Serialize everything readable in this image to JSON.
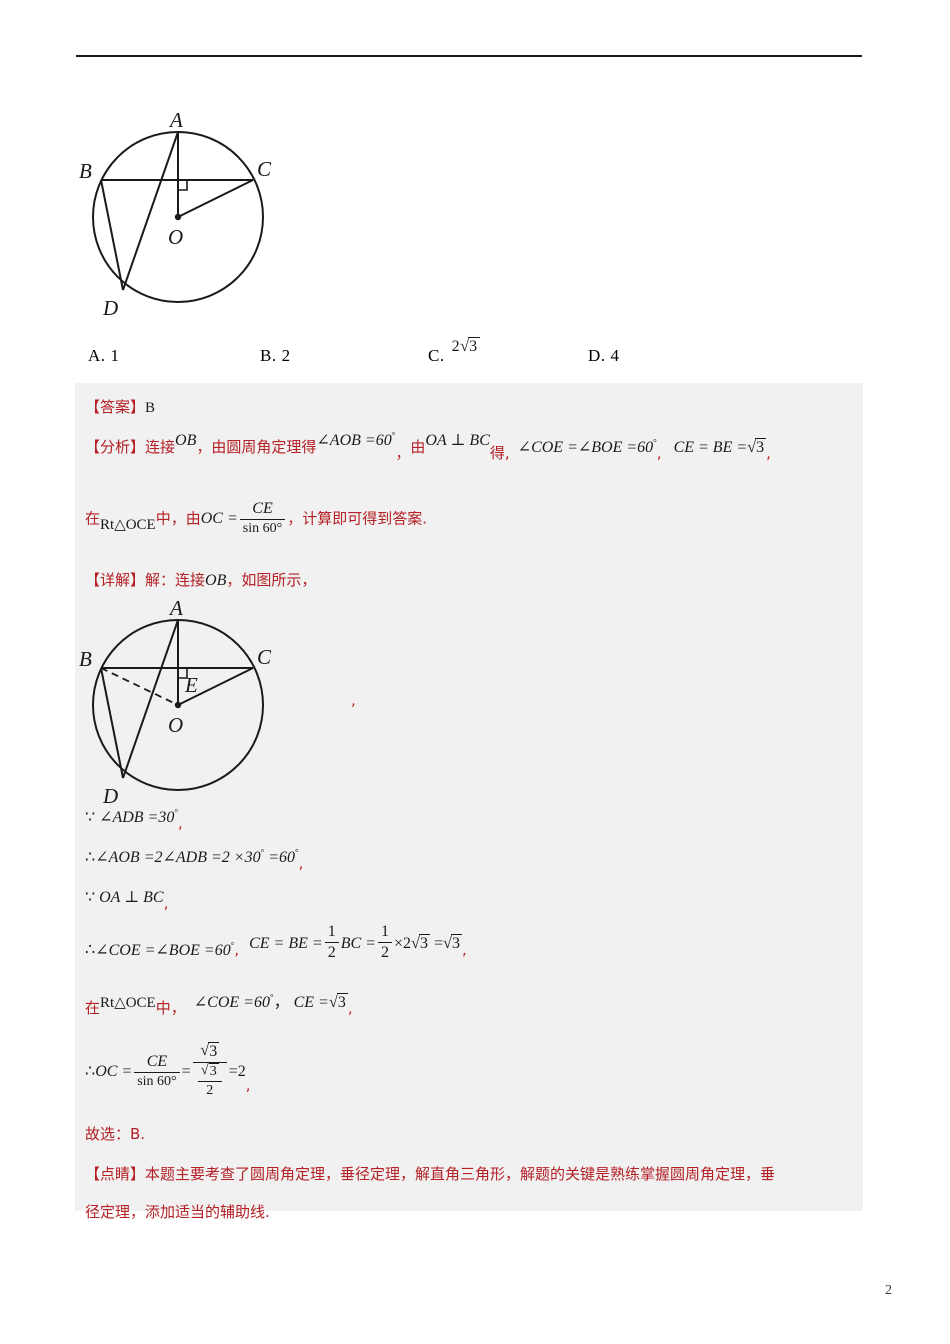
{
  "document": {
    "page_number": "2",
    "header_rule": true
  },
  "figure1": {
    "name": "circle-diagram-1",
    "labels": {
      "A": "A",
      "B": "B",
      "C": "C",
      "D": "D",
      "O": "O"
    },
    "right_angle_mark": true,
    "dashed_segment": false
  },
  "figure2": {
    "name": "circle-diagram-2",
    "labels": {
      "A": "A",
      "B": "B",
      "C": "C",
      "D": "D",
      "O": "O",
      "E": "E"
    },
    "right_angle_mark": true,
    "dashed_segment": true,
    "trailing_comma": ","
  },
  "options": [
    {
      "label": "A.",
      "value": "1"
    },
    {
      "label": "B.",
      "value": "2"
    },
    {
      "label": "C.",
      "value_prefix": "2",
      "value_sqrt": "3"
    },
    {
      "label": "D.",
      "value": "4"
    }
  ],
  "answer": {
    "tag": "【答案】",
    "value": "B"
  },
  "analysis": {
    "tag": "【分析】",
    "t1": "连接",
    "m1": "OB",
    "c1": "，",
    "t2": "由圆周角定理得",
    "m2": "∠AOB =60",
    "deg2": "°",
    "c2": "，",
    "t3": "由",
    "m3": "OA ⊥ BC",
    "t4": "得,",
    "m4": "∠COE =∠BOE =60",
    "deg4": "°",
    "c3": ",",
    "m5a": "CE = BE =",
    "m5_sqrt": "3",
    "c4": ",",
    "line2_t1": "在",
    "line2_m1": "Rt△OCE",
    "line2_t2": "中，由",
    "line2_m2": "OC =",
    "line2_frac_num": "CE",
    "line2_frac_den": "sin 60°",
    "line2_c1": "，",
    "line2_t3": "计算即可得到答案."
  },
  "solution": {
    "tag": "【详解】",
    "t1": "解：连接",
    "m1": "OB",
    "c1": "，",
    "t2": "如图所示，",
    "steps": [
      {
        "name": "step-adb",
        "prefix": "∵",
        "math": "∠ADB =30",
        "deg": "°",
        "comma": ","
      },
      {
        "name": "step-aob",
        "prefix": "∴",
        "math": "∠AOB =2∠ADB =2 ×30",
        "deg": "°",
        "math2": " =60",
        "deg2": "°",
        "comma": ","
      },
      {
        "name": "step-oa-perp-bc",
        "prefix": "∵",
        "math": "OA ⊥ BC",
        "comma": ","
      }
    ],
    "step_coe": {
      "prefix": "∴",
      "math": "∠COE =∠BOE =60",
      "deg": "°",
      "comma": ",",
      "math2a": "CE = BE =",
      "frac1_num": "1",
      "frac1_den": "2",
      "math2b": "BC =",
      "frac2_num": "1",
      "frac2_den": "2",
      "math2c": "×2",
      "sqrt1": "3",
      "math2d": " =",
      "sqrt2": "3",
      "comma2": ","
    },
    "step_rt": {
      "t1": "在",
      "m1": "Rt△OCE",
      "t2": "中，",
      "m2": "∠COE =60",
      "deg": "°",
      "c1": "，",
      "m3": "CE =",
      "sqrt": "3",
      "c2": ","
    },
    "step_oc": {
      "prefix": "∴",
      "m1": "OC =",
      "frac_num": "CE",
      "frac_den": "sin 60°",
      "eq": "=",
      "frac2_num_sqrt": "3",
      "frac2_den_sqrt": "3",
      "frac2_den_den": "2",
      "result": "=2",
      "comma": ","
    },
    "conclusion": "故选：B."
  },
  "insight": {
    "tag": "【点睛】",
    "line1": "本题主要考查了圆周角定理，垂径定理，解直角三角形，解题的关键是熟练掌握圆周角定理，垂",
    "line2": "径定理，添加适当的辅助线."
  },
  "colors": {
    "red": "#b42025",
    "panel_bg": "#f1f1f1",
    "ink": "#1a1a1a"
  }
}
